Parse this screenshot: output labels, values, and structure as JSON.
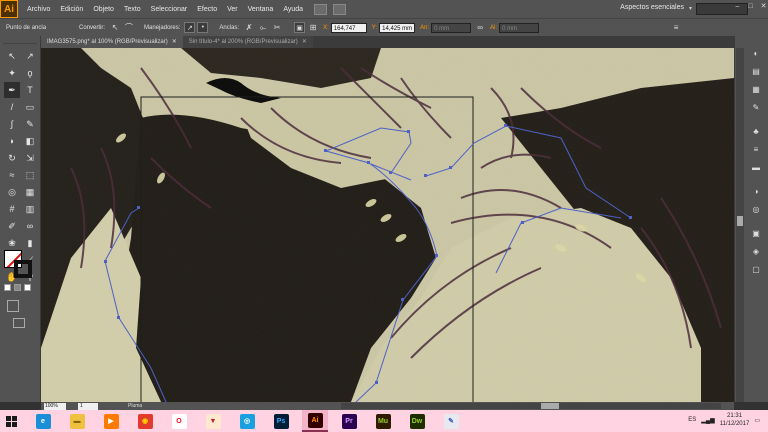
{
  "app": {
    "logo": "Ai"
  },
  "menu": [
    "Archivo",
    "Edición",
    "Objeto",
    "Texto",
    "Seleccionar",
    "Efecto",
    "Ver",
    "Ventana",
    "Ayuda"
  ],
  "workspace": "Aspectos esenciales",
  "window_controls": [
    "–",
    "□",
    "✕"
  ],
  "control_bar": {
    "anchor_label": "Punto de ancla",
    "convert_label": "Convertir:",
    "handles_label": "Manejadores:",
    "anchors_label": "Anclas:",
    "x_label": "X:",
    "x_value": "164,747 mm",
    "y_label": "Y:",
    "y_value": "14,425 mm",
    "w_label": "An:",
    "w_value": "0 mm",
    "h_label": "Al:",
    "h_value": "0 mm"
  },
  "tabs": [
    {
      "label": "IMAG3575.png* al 100% (RGB/Previsualizar)",
      "close": "✕",
      "active": true
    },
    {
      "label": "Sin título-4* al 200% (RGB/Previsualizar)",
      "close": "✕",
      "active": false
    }
  ],
  "status_bar": {
    "zoom": "100%",
    "page": "1",
    "tool": "Pluma"
  },
  "tools": [
    {
      "icon": "selection-tool-icon",
      "glyph": "↖"
    },
    {
      "icon": "direct-selection-tool-icon",
      "glyph": "↗"
    },
    {
      "icon": "magic-wand-tool-icon",
      "glyph": "✦"
    },
    {
      "icon": "lasso-tool-icon",
      "glyph": "ϙ"
    },
    {
      "icon": "pen-tool-icon",
      "glyph": "✒"
    },
    {
      "icon": "type-tool-icon",
      "glyph": "T"
    },
    {
      "icon": "line-tool-icon",
      "glyph": "/"
    },
    {
      "icon": "rectangle-tool-icon",
      "glyph": "▭"
    },
    {
      "icon": "paintbrush-tool-icon",
      "glyph": "∫"
    },
    {
      "icon": "pencil-tool-icon",
      "glyph": "✎"
    },
    {
      "icon": "blob-brush-tool-icon",
      "glyph": "◗"
    },
    {
      "icon": "eraser-tool-icon",
      "glyph": "◧"
    },
    {
      "icon": "rotate-tool-icon",
      "glyph": "↻"
    },
    {
      "icon": "scale-tool-icon",
      "glyph": "⇲"
    },
    {
      "icon": "width-tool-icon",
      "glyph": "≈"
    },
    {
      "icon": "free-transform-tool-icon",
      "glyph": "⬚"
    },
    {
      "icon": "shape-builder-tool-icon",
      "glyph": "◎"
    },
    {
      "icon": "perspective-grid-tool-icon",
      "glyph": "▦"
    },
    {
      "icon": "mesh-tool-icon",
      "glyph": "#"
    },
    {
      "icon": "gradient-tool-icon",
      "glyph": "▥"
    },
    {
      "icon": "eyedropper-tool-icon",
      "glyph": "✐"
    },
    {
      "icon": "blend-tool-icon",
      "glyph": "∞"
    },
    {
      "icon": "symbol-sprayer-tool-icon",
      "glyph": "❀"
    },
    {
      "icon": "column-graph-tool-icon",
      "glyph": "▮"
    },
    {
      "icon": "artboard-tool-icon",
      "glyph": "◰"
    },
    {
      "icon": "slice-tool-icon",
      "glyph": "⟋"
    },
    {
      "icon": "hand-tool-icon",
      "glyph": "✋"
    },
    {
      "icon": "zoom-tool-icon",
      "glyph": "⚲"
    }
  ],
  "right_panel_icons": [
    {
      "icon": "color-panel-icon",
      "glyph": "◐"
    },
    {
      "icon": "color-guide-icon",
      "glyph": "▤"
    },
    {
      "icon": "swatches-icon",
      "glyph": "▦"
    },
    {
      "icon": "brushes-icon",
      "glyph": "✎"
    },
    {
      "icon": "symbols-icon",
      "glyph": "♣"
    },
    {
      "icon": "stroke-panel-icon",
      "glyph": "≡"
    },
    {
      "icon": "gradient-panel-icon",
      "glyph": "▬"
    },
    {
      "icon": "transparency-icon",
      "glyph": "◑"
    },
    {
      "icon": "appearance-icon",
      "glyph": "◎"
    },
    {
      "icon": "graphic-styles-icon",
      "glyph": "▣"
    },
    {
      "icon": "layers-icon",
      "glyph": "◈"
    },
    {
      "icon": "artboards-icon",
      "glyph": "▢"
    }
  ],
  "taskbar": {
    "apps": [
      {
        "name": "internet-explorer",
        "glyph": "e",
        "bg": "#1a8fd8",
        "fg": "#ffffff"
      },
      {
        "name": "file-explorer",
        "glyph": "▬",
        "bg": "#f0c040",
        "fg": "#8a6500"
      },
      {
        "name": "media-player",
        "glyph": "▶",
        "bg": "#ff7a00",
        "fg": "#ffffff"
      },
      {
        "name": "chrome",
        "glyph": "◉",
        "bg": "#e23b2e",
        "fg": "#ffd000"
      },
      {
        "name": "opera",
        "glyph": "O",
        "bg": "#ffffff",
        "fg": "#e01020"
      },
      {
        "name": "popcorn",
        "glyph": "▼",
        "bg": "#ffe8d0",
        "fg": "#c02020"
      },
      {
        "name": "network-app",
        "glyph": "◎",
        "bg": "#1aa0e0",
        "fg": "#ffffff"
      },
      {
        "name": "photoshop",
        "glyph": "Ps",
        "bg": "#001e36",
        "fg": "#31a8ff"
      },
      {
        "name": "illustrator",
        "glyph": "Ai",
        "bg": "#330000",
        "fg": "#ff9a00"
      },
      {
        "name": "premiere",
        "glyph": "Pr",
        "bg": "#2a0050",
        "fg": "#d99bff"
      },
      {
        "name": "muse",
        "glyph": "Mu",
        "bg": "#2e1b00",
        "fg": "#9acd32"
      },
      {
        "name": "dreamweaver",
        "glyph": "Dw",
        "bg": "#1c2e00",
        "fg": "#9acd32"
      },
      {
        "name": "paint",
        "glyph": "✎",
        "bg": "#e8e8f0",
        "fg": "#4060c0"
      }
    ],
    "lang": "ES",
    "time": "21:31",
    "date": "11/12/2017"
  }
}
